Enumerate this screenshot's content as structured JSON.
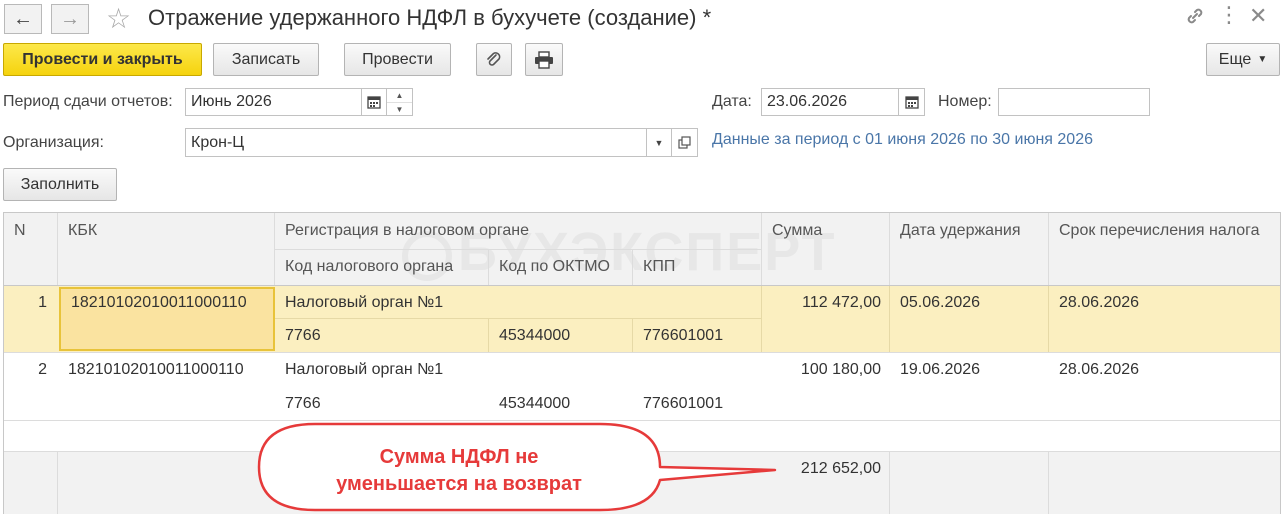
{
  "window": {
    "title": "Отражение удержанного НДФЛ в бухучете (создание) *"
  },
  "toolbar": {
    "post_close": "Провести и закрыть",
    "save": "Записать",
    "post": "Провести",
    "more": "Еще"
  },
  "form": {
    "period_label": "Период сдачи отчетов:",
    "period_value": "Июнь 2026",
    "date_label": "Дата:",
    "date_value": "23.06.2026",
    "number_label": "Номер:",
    "number_value": "",
    "org_label": "Организация:",
    "org_value": "Крон-Ц",
    "period_info": "Данные за период с 01 июня 2026 по 30 июня 2026",
    "fill_button": "Заполнить"
  },
  "table": {
    "headers": {
      "n": "N",
      "kbk": "КБК",
      "registration": "Регистрация в налоговом органе",
      "tax_code": "Код налогового органа",
      "oktmo": "Код по ОКТМО",
      "kpp": "КПП",
      "sum": "Сумма",
      "date": "Дата удержания",
      "due": "Срок перечисления налога"
    },
    "rows": [
      {
        "n": "1",
        "kbk": "18210102010011000110",
        "reg": "Налоговый орган №1",
        "tax_code": "7766",
        "oktmo": "45344000",
        "kpp": "776601001",
        "sum": "112 472,00",
        "date": "05.06.2026",
        "due": "28.06.2026"
      },
      {
        "n": "2",
        "kbk": "18210102010011000110",
        "reg": "Налоговый орган №1",
        "tax_code": "7766",
        "oktmo": "45344000",
        "kpp": "776601001",
        "sum": "100 180,00",
        "date": "19.06.2026",
        "due": "28.06.2026"
      }
    ],
    "total_sum": "212 652,00"
  },
  "watermark": "БУХЭКСПЕРТ",
  "callout": {
    "line1": "Сумма НДФЛ не",
    "line2": "уменьшается на возврат"
  },
  "colors": {
    "accent_yellow": "#f5d30e",
    "selected_row": "#fbefc0",
    "callout_red": "#e63a3a",
    "link_blue": "#4a76a8"
  }
}
